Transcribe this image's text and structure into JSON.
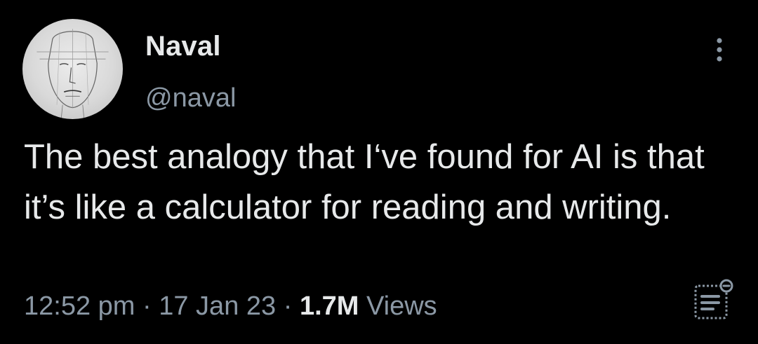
{
  "author": {
    "display_name": "Naval",
    "handle": "@naval",
    "avatar_icon": "sketched-face-avatar"
  },
  "tweet": {
    "text": "The best analogy that I‘ve found for AI is that it’s like a calculator for reading and writing."
  },
  "meta": {
    "time": "12:52 pm",
    "separator": "·",
    "date": "17 Jan 23",
    "views_count": "1.7M",
    "views_label": "Views"
  },
  "icons": {
    "more": "more-vertical-icon",
    "analytics": "view-analytics-icon"
  },
  "colors": {
    "background": "#000000",
    "primary_text": "#e7e9ea",
    "secondary_text": "#8b98a5"
  }
}
